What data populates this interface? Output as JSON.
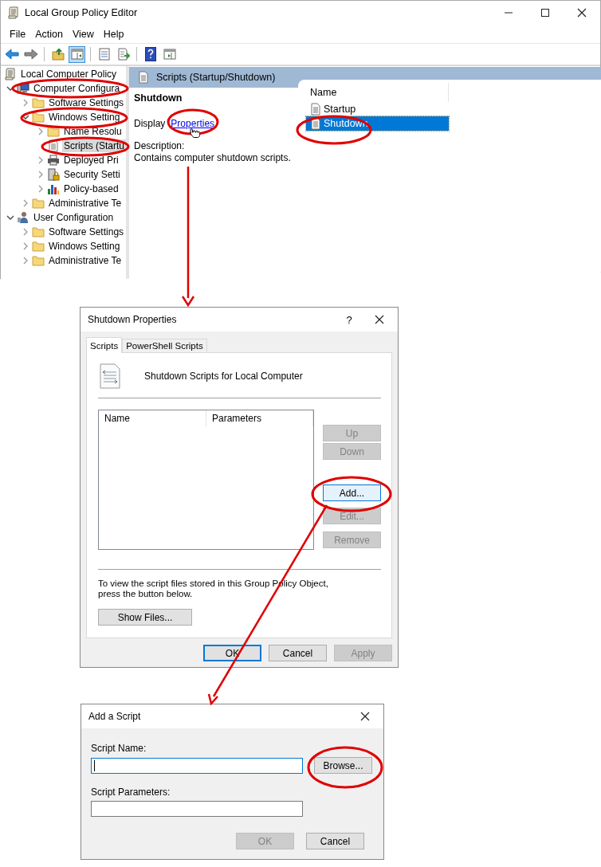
{
  "window": {
    "title": "Local Group Policy Editor",
    "menu": [
      {
        "label": "File"
      },
      {
        "label": "Action"
      },
      {
        "label": "View"
      },
      {
        "label": "Help"
      }
    ],
    "toolbar": [
      {
        "kind": "back",
        "pressed": false
      },
      {
        "kind": "forward",
        "pressed": false
      },
      {
        "kind": "sep"
      },
      {
        "kind": "up",
        "pressed": false
      },
      {
        "kind": "tree",
        "pressed": true
      },
      {
        "kind": "sep"
      },
      {
        "kind": "properties",
        "pressed": false
      },
      {
        "kind": "export",
        "pressed": false
      },
      {
        "kind": "sep"
      },
      {
        "kind": "help",
        "pressed": false
      },
      {
        "kind": "action",
        "pressed": false
      }
    ],
    "tree": [
      {
        "label": "Local Computer Policy",
        "kind": "policy",
        "selected": false,
        "children": [
          {
            "label": "Computer Configura",
            "kind": "computer",
            "expanded": true,
            "selected": false,
            "children": [
              {
                "label": "Software Settings",
                "kind": "folder",
                "expanded": false,
                "selected": false
              },
              {
                "label": "Windows Setting",
                "kind": "folder",
                "expanded": true,
                "selected": false,
                "children": [
                  {
                    "label": "Name Resolu",
                    "kind": "folder",
                    "expanded": false,
                    "selected": false
                  },
                  {
                    "label": "Scripts (Startu",
                    "kind": "scripts",
                    "selected": true
                  },
                  {
                    "label": "Deployed Pri",
                    "kind": "printer",
                    "expanded": false,
                    "selected": false
                  },
                  {
                    "label": "Security Setti",
                    "kind": "security",
                    "expanded": false,
                    "selected": false
                  },
                  {
                    "label": "Policy-based",
                    "kind": "chart",
                    "expanded": false,
                    "selected": false
                  }
                ]
              },
              {
                "label": "Administrative Te",
                "kind": "folder",
                "expanded": false,
                "selected": false
              }
            ]
          },
          {
            "label": "User Configuration",
            "kind": "user",
            "expanded": true,
            "selected": false,
            "children": [
              {
                "label": "Software Settings",
                "kind": "folder",
                "expanded": false,
                "selected": false
              },
              {
                "label": "Windows Setting",
                "kind": "folder",
                "expanded": false,
                "selected": false
              },
              {
                "label": "Administrative Te",
                "kind": "folder",
                "expanded": false,
                "selected": false
              }
            ]
          }
        ]
      }
    ],
    "details": {
      "header": "Scripts (Startup/Shutdown)",
      "heading": "Shutdown",
      "display_label": "Display",
      "display_link": "Properties",
      "description_label": "Description:",
      "description": "Contains computer shutdown scripts."
    },
    "list": {
      "column": "Name",
      "items": [
        {
          "label": "Startup",
          "selected": false
        },
        {
          "label": "Shutdown",
          "selected": true
        }
      ]
    }
  },
  "properties_dialog": {
    "title": "Shutdown Properties",
    "help": "?",
    "tabs": [
      {
        "label": "Scripts",
        "selected": true
      },
      {
        "label": "PowerShell Scripts",
        "selected": false
      }
    ],
    "heading": "Shutdown Scripts for Local Computer",
    "columns": [
      "Name",
      "Parameters"
    ],
    "side_buttons": [
      {
        "label": "Up",
        "disabled": true,
        "focused": false
      },
      {
        "label": "Down",
        "disabled": true,
        "focused": false
      },
      {
        "label": "Add...",
        "disabled": false,
        "focused": true
      },
      {
        "label": "Edit...",
        "disabled": true,
        "focused": false
      },
      {
        "label": "Remove",
        "disabled": true,
        "focused": false
      }
    ],
    "note": "To view the script files stored in this Group Policy Object, press the button below.",
    "show_files": "Show Files...",
    "buttons": [
      {
        "label": "OK",
        "disabled": false,
        "default": true
      },
      {
        "label": "Cancel",
        "disabled": false,
        "default": false
      },
      {
        "label": "Apply",
        "disabled": true,
        "default": false
      }
    ]
  },
  "add_script_dialog": {
    "title": "Add a Script",
    "fields": [
      {
        "label": "Script Name:",
        "focused": true
      },
      {
        "label": "Script Parameters:",
        "focused": false
      }
    ],
    "browse": "Browse...",
    "buttons": [
      {
        "label": "OK",
        "disabled": true
      },
      {
        "label": "Cancel",
        "disabled": false
      }
    ]
  }
}
